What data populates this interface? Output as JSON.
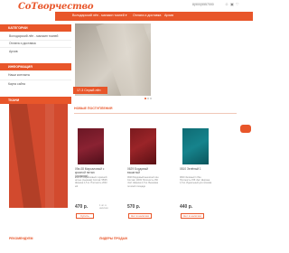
{
  "header": {
    "logo": "СоТворчество",
    "phone": "8(900)5557000"
  },
  "nav": {
    "items": [
      "Володарский лён - магазин тканей ▾",
      "Оплата и доставка",
      "Архив"
    ]
  },
  "sidebar": {
    "categories_title": "КАТЕГОРИИ",
    "categories": [
      "Володарский лён - магазин тканей",
      "Оплата и доставка",
      "Архив"
    ],
    "info_title": "ИНФОРМАЦИЯ",
    "info": [
      "Наши контакты",
      "Карта сайта"
    ],
    "fabrics_title": "ТКАНИ"
  },
  "slider": {
    "caption": "17-3 Серый лён"
  },
  "new_arrivals": {
    "title": "НОВЫЕ ПОСТУПЛЕНИЯ",
    "products": [
      {
        "name": "09а-08 Марсаловый с красной нитью (льняная)",
        "desc": "09а-08 Марсаловый с красной нитью (льняная) Состав: 55/45 Ширина 1,5 м. Плотность 200г/м2",
        "price": "470 р.",
        "qty": "1 шт. в наличии",
        "button": "Купить"
      },
      {
        "name": "0629 Бордовый вышитый",
        "desc": "0629 Бордовый вышитый лён Состав: 100% Плотность 150 г/м2. Ширина 1,5 м. Вышивка по всей площади",
        "price": "570 р.",
        "qty": "",
        "button": "Нет в наличии"
      },
      {
        "name": "0810 Зелёный 1",
        "desc": "0810 Зелёный 1 Лён Плотность 155 г/м2. Ширина 1,5 м. Идеальный для пошива",
        "price": "440 р.",
        "qty": "",
        "button": "Нет в наличии"
      }
    ]
  },
  "bottom": {
    "left_title": "РЕКОМЕНДУЕМ",
    "right_title": "ЛИДЕРЫ ПРОДАЖ"
  }
}
